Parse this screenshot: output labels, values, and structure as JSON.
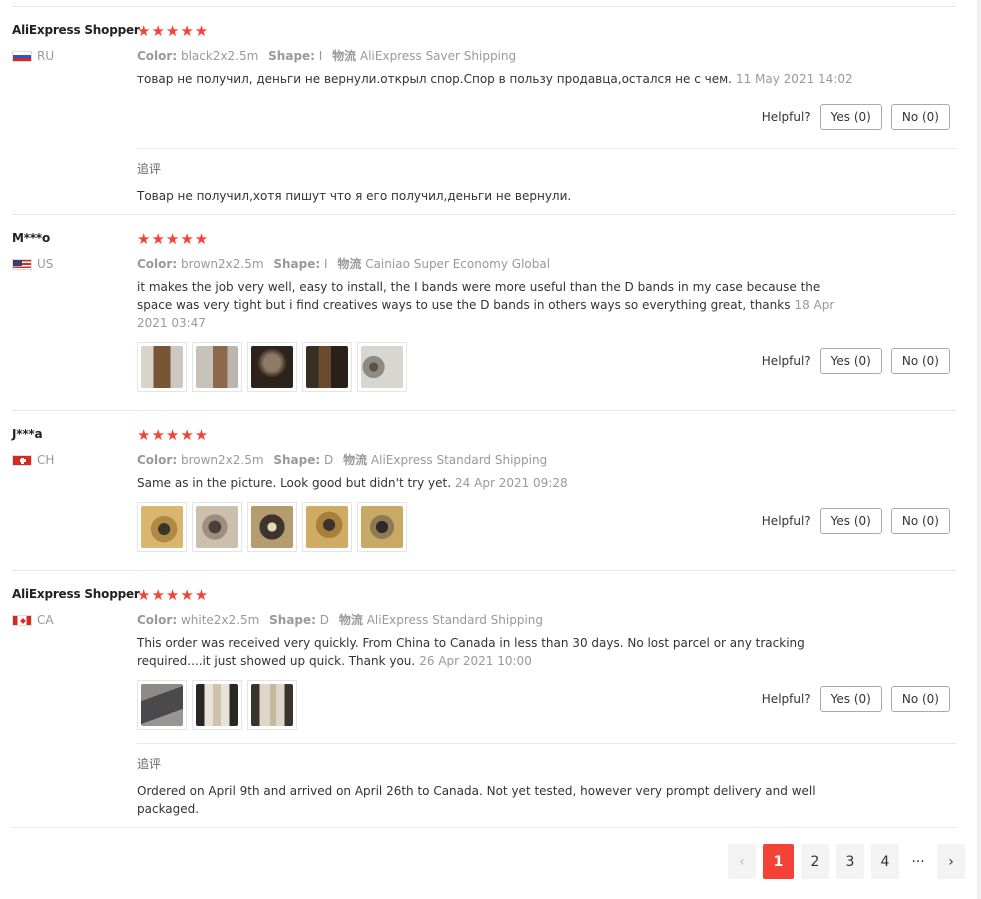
{
  "reviews": [
    {
      "user": "AliExpress Shopper",
      "country": "RU",
      "stars": "★★★★★",
      "color_label": "Color:",
      "color": "black2x2.5m",
      "shape_label": "Shape:",
      "shape": "I",
      "ship_label": "物流",
      "shipping": "AliExpress Saver Shipping",
      "text": "товар не получил, деньги не вернули.открыл спор.Спор в пользу продавца,остался не с чем.",
      "date": "11 May 2021 14:02",
      "helpful_label": "Helpful?",
      "yes": "Yes (0)",
      "no": "No (0)",
      "followup_label": "追评",
      "followup_text": "Товар не получил,хотя пишут что я его получил,деньги не вернули."
    },
    {
      "user": "M***o",
      "country": "US",
      "stars": "★★★★★",
      "color_label": "Color:",
      "color": "brown2x2.5m",
      "shape_label": "Shape:",
      "shape": "I",
      "ship_label": "物流",
      "shipping": "Cainiao Super Economy Global",
      "text": "it makes the job very well, easy to install, the I bands were more useful than the D bands in my case because the space was very tight but i find creatives ways to use the D bands in others ways so everything great, thanks",
      "date": "18 Apr 2021 03:47",
      "helpful_label": "Helpful?",
      "yes": "Yes (0)",
      "no": "No (0)"
    },
    {
      "user": "J***a",
      "country": "CH",
      "stars": "★★★★★",
      "color_label": "Color:",
      "color": "brown2x2.5m",
      "shape_label": "Shape:",
      "shape": "D",
      "ship_label": "物流",
      "shipping": "AliExpress Standard Shipping",
      "text": "Same as in the picture. Look good but didn't try yet.",
      "date": "24 Apr 2021 09:28",
      "helpful_label": "Helpful?",
      "yes": "Yes (0)",
      "no": "No (0)"
    },
    {
      "user": "AliExpress Shopper",
      "country": "CA",
      "stars": "★★★★★",
      "color_label": "Color:",
      "color": "white2x2.5m",
      "shape_label": "Shape:",
      "shape": "D",
      "ship_label": "物流",
      "shipping": "AliExpress Standard Shipping",
      "text": "This order was received very quickly. From China to Canada in less than 30 days. No lost parcel or any tracking required....it just showed up quick. Thank you.",
      "date": "26 Apr 2021 10:00",
      "helpful_label": "Helpful?",
      "yes": "Yes (0)",
      "no": "No (0)",
      "followup_label": "追评",
      "followup_text": "Ordered on April 9th and arrived on April 26th to Canada. Not yet tested, however very prompt delivery and well packaged."
    }
  ],
  "pagination": {
    "prev": "‹",
    "pages": [
      "1",
      "2",
      "3",
      "4"
    ],
    "active": "1",
    "ellipsis": "···",
    "next": "›"
  },
  "colors": {
    "star": "#f44336",
    "active_page": "#f44336"
  }
}
